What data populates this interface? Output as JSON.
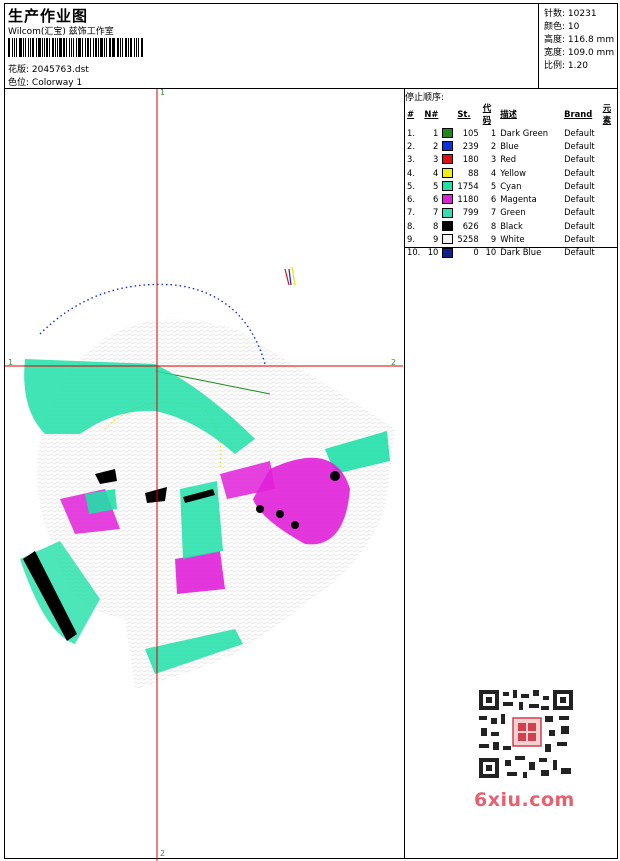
{
  "header": {
    "title": "生产作业图",
    "company": "Wilcom(汇宝) 兹饰工作室",
    "file_label": "花版:",
    "file_name": "2045763.dst",
    "colorway_label": "色位:",
    "colorway_name": "Colorway 1"
  },
  "stats": [
    {
      "label": "针数:",
      "value": "10231"
    },
    {
      "label": "颜色:",
      "value": "10"
    },
    {
      "label": "高度:",
      "value": "116.8 mm"
    },
    {
      "label": "宽度:",
      "value": "109.0 mm"
    },
    {
      "label": "比例:",
      "value": "1.20"
    }
  ],
  "stop_sequence": {
    "title": "停止顺序:",
    "headers": [
      "#",
      "N#",
      "St.",
      "代码",
      "描述",
      "Brand",
      "元素"
    ],
    "rows": [
      {
        "idx": "1.",
        "n": "1",
        "color": "#1a8a1a",
        "st": "105",
        "code": "1",
        "desc": "Dark Green",
        "brand": "Default"
      },
      {
        "idx": "2.",
        "n": "2",
        "color": "#1030e0",
        "st": "239",
        "code": "2",
        "desc": "Blue",
        "brand": "Default"
      },
      {
        "idx": "3.",
        "n": "3",
        "color": "#e01010",
        "st": "180",
        "code": "3",
        "desc": "Red",
        "brand": "Default"
      },
      {
        "idx": "4.",
        "n": "4",
        "color": "#f0f010",
        "st": "88",
        "code": "4",
        "desc": "Yellow",
        "brand": "Default"
      },
      {
        "idx": "5.",
        "n": "5",
        "color": "#20e0a8",
        "st": "1754",
        "code": "5",
        "desc": "Cyan",
        "brand": "Default"
      },
      {
        "idx": "6.",
        "n": "6",
        "color": "#e020d8",
        "st": "1180",
        "code": "6",
        "desc": "Magenta",
        "brand": "Default"
      },
      {
        "idx": "7.",
        "n": "7",
        "color": "#30e0b0",
        "st": "799",
        "code": "7",
        "desc": "Green",
        "brand": "Default"
      },
      {
        "idx": "8.",
        "n": "8",
        "color": "#000000",
        "st": "626",
        "code": "8",
        "desc": "Black",
        "brand": "Default"
      },
      {
        "idx": "9.",
        "n": "9",
        "color": "#f4f4f4",
        "st": "5258",
        "code": "9",
        "desc": "White",
        "brand": "Default"
      },
      {
        "idx": "10.",
        "n": "10",
        "color": "#102090",
        "st": "0",
        "code": "10",
        "desc": "Dark Blue",
        "brand": "Default"
      }
    ]
  },
  "axes": {
    "top": "1",
    "bottom": "2",
    "left": "1",
    "right": "2"
  },
  "watermark": "6xiu.com",
  "colors": {
    "crosshair": "#e00000",
    "axis_label": "#3c8f3c",
    "cyan": "#20e0a8",
    "magenta": "#e020d8",
    "watermark": "#e86070"
  }
}
